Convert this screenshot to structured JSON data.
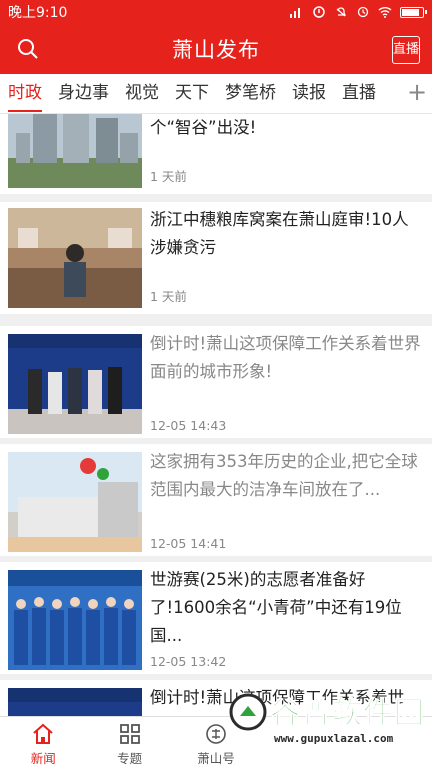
{
  "status_bar": {
    "time": "晚上9:10",
    "battery_level": 0.9
  },
  "app_bar": {
    "title": "萧山发布",
    "search_icon": "search-icon",
    "live_button_label": "直播"
  },
  "tabs": {
    "items": [
      "时政",
      "身边事",
      "视觉",
      "天下",
      "梦笔桥",
      "读报",
      "直播"
    ],
    "active_index": 0,
    "more_icon": "+"
  },
  "news": [
    {
      "headline": "大动作!数字经济独角兽将在萧山这个“智谷”出没!",
      "time": "1 天前",
      "read": false,
      "image": "city-buildings"
    },
    {
      "headline": "浙江中穗粮库窝案在萧山庭审!10人涉嫌贪污",
      "time": "1 天前",
      "read": false,
      "image": "courtroom"
    },
    {
      "headline": "倒计时!萧山这项保障工作关系着世界面前的城市形象!",
      "time": "12-05 14:43",
      "read": true,
      "image": "fina-stage"
    },
    {
      "headline": "这家拥有353年历史的企业,把它全球范围内最大的洁净车间放在了...",
      "time": "12-05 14:41",
      "read": true,
      "image": "factory-balloons"
    },
    {
      "headline": "世游赛(25米)的志愿者准备好了!1600余名“小青荷”中还有19位国...",
      "time": "12-05 13:42",
      "read": false,
      "image": "volunteers"
    },
    {
      "headline": "倒计时!萧山这项保障工作关系着世",
      "time": "",
      "read": false,
      "image": "fina-stage"
    }
  ],
  "bottom_nav": [
    {
      "label": "新闻",
      "icon": "home-icon",
      "active": true
    },
    {
      "label": "专题",
      "icon": "grid-icon",
      "active": false
    },
    {
      "label": "萧山号",
      "icon": "seal-icon",
      "active": false
    }
  ],
  "watermark": {
    "name": "谷普软件园",
    "url": "www.gupuxlazal.com"
  },
  "colors": {
    "brand": "#e5221c",
    "text": "#222222",
    "secondary": "#888888"
  }
}
